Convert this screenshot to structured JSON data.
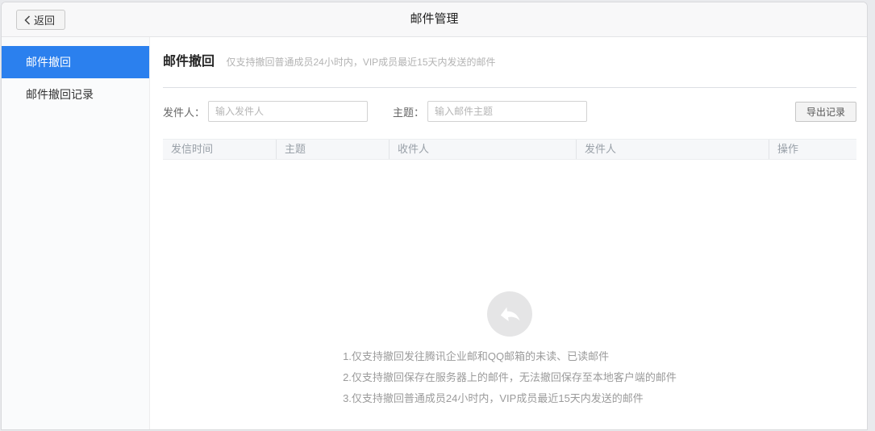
{
  "colors": {
    "accent": "#2b80ee",
    "backdrop": "#e9eaed",
    "table_header_bg": "#f6f7f9"
  },
  "topbar": {
    "back_label": "返回",
    "title": "邮件管理"
  },
  "sidebar": {
    "items": [
      {
        "label": "邮件撤回",
        "active": true
      },
      {
        "label": "邮件撤回记录",
        "active": false
      }
    ]
  },
  "section": {
    "title": "邮件撤回",
    "subtitle": "仅支持撤回普通成员24小时内，VIP成员最近15天内发送的邮件"
  },
  "filters": {
    "sender_label": "发件人：",
    "sender_placeholder": "输入发件人",
    "sender_value": "",
    "subject_label": "主题：",
    "subject_placeholder": "输入邮件主题",
    "subject_value": "",
    "export_label": "导出记录"
  },
  "table": {
    "columns": [
      "发信时间",
      "主题",
      "收件人",
      "发件人",
      "操作"
    ],
    "rows": []
  },
  "empty_state": {
    "icon": "recall-reply-icon",
    "tips": [
      "1.仅支持撤回发往腾讯企业邮和QQ邮箱的未读、已读邮件",
      "2.仅支持撤回保存在服务器上的邮件，无法撤回保存至本地客户端的邮件",
      "3.仅支持撤回普通成员24小时内，VIP成员最近15天内发送的邮件"
    ]
  }
}
